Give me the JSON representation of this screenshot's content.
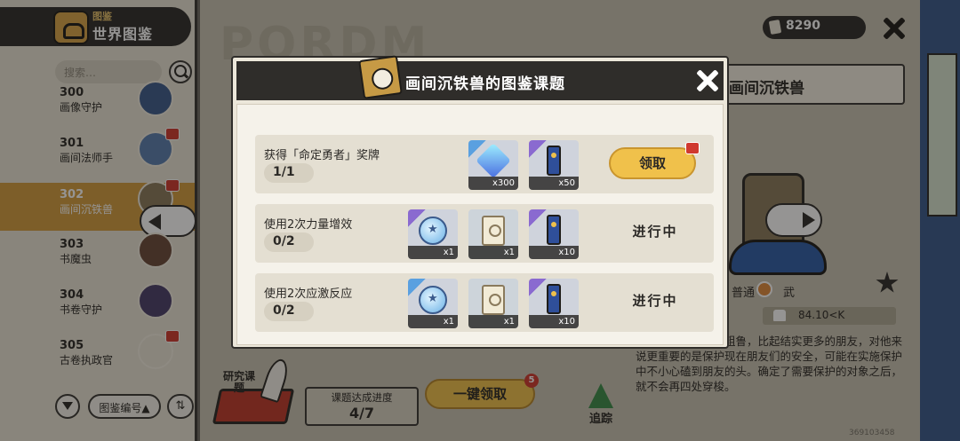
{
  "sidebar": {
    "subtitle": "图鉴",
    "title": "世界图鉴",
    "search_placeholder": "搜索…",
    "entries": [
      {
        "num": "300",
        "name": "画像守护"
      },
      {
        "num": "301",
        "name": "画间法师手"
      },
      {
        "num": "302",
        "name": "画间沉铁兽"
      },
      {
        "num": "303",
        "name": "书魔虫"
      },
      {
        "num": "304",
        "name": "书卷守护"
      },
      {
        "num": "305",
        "name": "古卷执政官"
      }
    ],
    "sort_label": "图鉴编号▲",
    "sort_toggle": "⇅"
  },
  "main": {
    "bg_letters": "PORDM",
    "currency": "8290",
    "creature_name": "画间沉铁兽",
    "attr_type": "普通",
    "attr_weapon": "武",
    "weight": "84.10<K",
    "description": "支形态，稍微有些粗鲁，比起结实更多的朋友，对他来说更重要的是保护现在朋友们的安全，可能在实施保护中不小心磕到朋友的头。确定了需要保护的对象之后，就不会再四处穿梭。",
    "research_label": "研究课题",
    "progress_label": "课题达成进度",
    "progress_value": "4/7",
    "claim_all_label": "一键领取",
    "claim_all_count": "5",
    "track_label": "追踪",
    "uid": "369103458"
  },
  "modal": {
    "title": "画间沉铁兽的图鉴课题",
    "tasks": [
      {
        "desc": "获得「命定勇者」奖牌",
        "progress": "1/1",
        "rewards": [
          {
            "icon": "crystal-gem-icon",
            "qty": "x300"
          },
          {
            "icon": "blue-tag-icon",
            "qty": "x50"
          }
        ],
        "action": "领取"
      },
      {
        "desc": "使用2次力量增效",
        "progress": "0/2",
        "rewards": [
          {
            "icon": "blue-orb-icon",
            "qty": "x1"
          },
          {
            "icon": "scroll-icon",
            "qty": "x1"
          },
          {
            "icon": "blue-tag-icon",
            "qty": "x10"
          }
        ],
        "action": "进行中"
      },
      {
        "desc": "使用2次应激反应",
        "progress": "0/2",
        "rewards": [
          {
            "icon": "blue-orb-icon",
            "qty": "x1"
          },
          {
            "icon": "scroll-icon",
            "qty": "x1"
          },
          {
            "icon": "blue-tag-icon",
            "qty": "x10"
          }
        ],
        "action": "进行中"
      }
    ]
  },
  "colors": {
    "accent_gold": "#f0c14b",
    "header_dark": "#2f2d2a",
    "gift_red": "#d0392f",
    "selected_entry": "#d49d3f"
  }
}
